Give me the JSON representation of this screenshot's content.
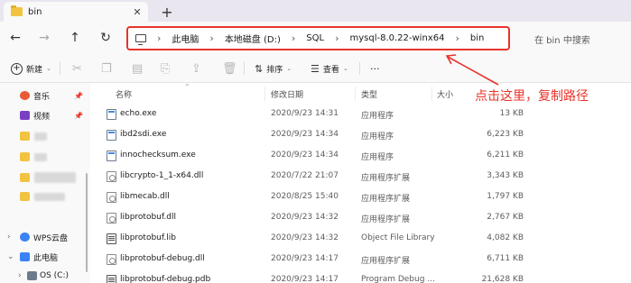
{
  "tab": {
    "title": "bin",
    "close": "✕",
    "new": "+"
  },
  "nav": {
    "back": "←",
    "forward": "→",
    "up": "↑",
    "refresh": "↻"
  },
  "address": {
    "crumbs": [
      "此电脑",
      "本地磁盘 (D:)",
      "SQL",
      "mysql-8.0.22-winx64",
      "bin"
    ],
    "separator": "›"
  },
  "search": {
    "placeholder": "在 bin 中搜索"
  },
  "toolbar": {
    "new_label": "新建",
    "sort_label": "排序",
    "view_label": "查看",
    "more": "···"
  },
  "sidebar": {
    "quick_access": [
      {
        "label": "音乐",
        "pinned": true,
        "color": "#e85a33"
      },
      {
        "label": "视频",
        "pinned": true,
        "color": "#7b3fc4"
      }
    ],
    "wps": "WPS云盘",
    "this_pc": "此电脑",
    "drive": "OS (C:)"
  },
  "columns": {
    "name": "名称",
    "date": "修改日期",
    "type": "类型",
    "size": "大小"
  },
  "files": [
    {
      "name": "echo.exe",
      "date": "2020/9/23 14:31",
      "type": "应用程序",
      "size": "13 KB",
      "kind": "exe"
    },
    {
      "name": "ibd2sdi.exe",
      "date": "2020/9/23 14:34",
      "type": "应用程序",
      "size": "6,223 KB",
      "kind": "exe"
    },
    {
      "name": "innochecksum.exe",
      "date": "2020/9/23 14:34",
      "type": "应用程序",
      "size": "6,211 KB",
      "kind": "exe"
    },
    {
      "name": "libcrypto-1_1-x64.dll",
      "date": "2020/7/22 21:07",
      "type": "应用程序扩展",
      "size": "3,343 KB",
      "kind": "dll"
    },
    {
      "name": "libmecab.dll",
      "date": "2020/8/25 15:40",
      "type": "应用程序扩展",
      "size": "1,797 KB",
      "kind": "dll"
    },
    {
      "name": "libprotobuf.dll",
      "date": "2020/9/23 14:32",
      "type": "应用程序扩展",
      "size": "2,767 KB",
      "kind": "dll"
    },
    {
      "name": "libprotobuf.lib",
      "date": "2020/9/23 14:32",
      "type": "Object File Library",
      "size": "4,082 KB",
      "kind": "lib"
    },
    {
      "name": "libprotobuf-debug.dll",
      "date": "2020/9/23 14:17",
      "type": "应用程序扩展",
      "size": "6,711 KB",
      "kind": "dll"
    },
    {
      "name": "libprotobuf-debug.pdb",
      "date": "2020/9/23 14:17",
      "type": "Program Debug ...",
      "size": "21,628 KB",
      "kind": "pdb"
    }
  ],
  "annotation": {
    "text": "点击这里，复制路径",
    "color": "#e8332a"
  }
}
